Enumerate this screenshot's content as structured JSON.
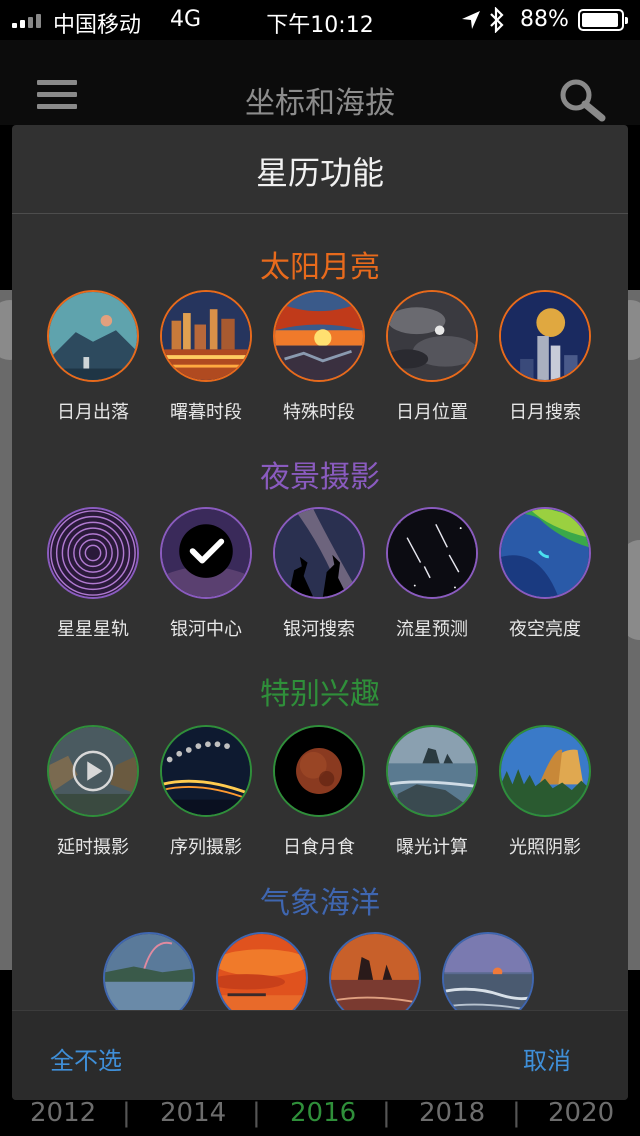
{
  "status_bar": {
    "carrier": "中国移动",
    "network": "4G",
    "time": "下午10:12",
    "battery_pct": "88%",
    "battery_level": 0.88
  },
  "nav": {
    "title": "坐标和海拔",
    "menu_icon": "hamburger-menu-icon",
    "search_icon": "search-icon"
  },
  "timeline": {
    "years": [
      "2012",
      "2014",
      "2016",
      "2018",
      "2020"
    ],
    "active": "2016"
  },
  "modal": {
    "title": "星历功能",
    "sections": [
      {
        "title": "太阳月亮",
        "color": "#e86a1c",
        "items": [
          {
            "label": "日月出落",
            "icon": "moon-over-mountain"
          },
          {
            "label": "曙暮时段",
            "icon": "city-skyline-dusk"
          },
          {
            "label": "特殊时段",
            "icon": "sun-through-arch"
          },
          {
            "label": "日月位置",
            "icon": "moon-in-clouds"
          },
          {
            "label": "日月搜索",
            "icon": "full-moon-tower"
          }
        ]
      },
      {
        "title": "夜景摄影",
        "color": "#8a5bbf",
        "items": [
          {
            "label": "星星星轨",
            "icon": "star-trails"
          },
          {
            "label": "银河中心",
            "icon": "galactic-center-checked"
          },
          {
            "label": "银河搜索",
            "icon": "milky-way-silhouette"
          },
          {
            "label": "流星预测",
            "icon": "meteor-shower"
          },
          {
            "label": "夜空亮度",
            "icon": "light-pollution-map"
          }
        ]
      },
      {
        "title": "特别兴趣",
        "color": "#2f8f3a",
        "items": [
          {
            "label": "延时摄影",
            "icon": "timelapse-play"
          },
          {
            "label": "序列摄影",
            "icon": "eclipse-sequence-bridge"
          },
          {
            "label": "日食月食",
            "icon": "blood-moon"
          },
          {
            "label": "曝光计算",
            "icon": "seascape-rocks"
          },
          {
            "label": "光照阴影",
            "icon": "half-dome-forest"
          }
        ]
      },
      {
        "title": "气象海洋",
        "color": "#3f66b0",
        "items": [
          {
            "label": "",
            "icon": "rainbow-lake"
          },
          {
            "label": "",
            "icon": "orange-sky-pier"
          },
          {
            "label": "",
            "icon": "sunset-sea-stacks"
          },
          {
            "label": "",
            "icon": "ocean-sunset"
          }
        ]
      }
    ],
    "footer": {
      "deselect_all": "全不选",
      "cancel": "取消"
    }
  }
}
